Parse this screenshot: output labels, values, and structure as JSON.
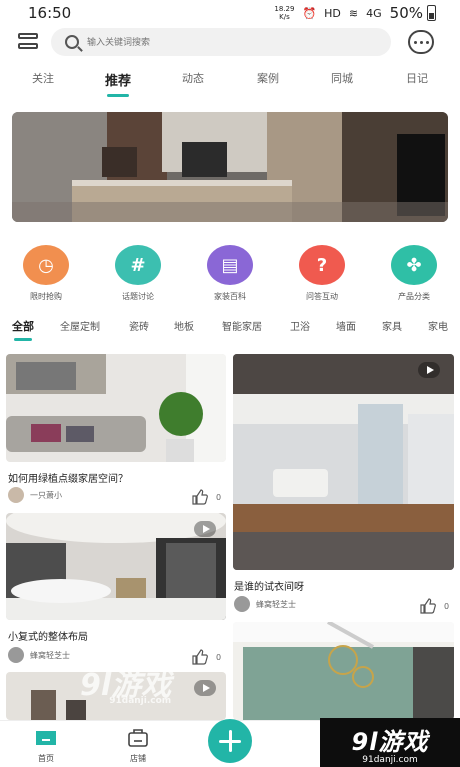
{
  "status": {
    "time": "16:50",
    "speed": "18.29\nK/s",
    "hd": "HD",
    "signal": "4G",
    "battery": "50%"
  },
  "search": {
    "placeholder": "输入关键词搜索"
  },
  "tabs": [
    "关注",
    "推荐",
    "动态",
    "案例",
    "同城",
    "日记"
  ],
  "categories": [
    {
      "label": "限时抢购",
      "color": "#f18f4f",
      "icon": "clock-icon"
    },
    {
      "label": "话题讨论",
      "color": "#3cbfb0",
      "icon": "hash-icon"
    },
    {
      "label": "家装百科",
      "color": "#8a67d6",
      "icon": "book-icon"
    },
    {
      "label": "问答互动",
      "color": "#f05a4f",
      "icon": "question-icon"
    },
    {
      "label": "产品分类",
      "color": "#2fbfa6",
      "icon": "grid-icon"
    }
  ],
  "subtabs": [
    "全部",
    "全屋定制",
    "瓷砖",
    "地板",
    "智能家居",
    "卫浴",
    "墙面",
    "家具",
    "家电"
  ],
  "cards": [
    {
      "title": "如何用绿植点缀家居空间？",
      "author": "一只萧小",
      "likes": "0"
    },
    {
      "title": "小复式的整体布局",
      "author": "蜂窝轻芝士",
      "likes": "0"
    },
    {
      "title": "是谁的试衣间呀",
      "author": "蜂窝轻芝士",
      "likes": "0"
    }
  ],
  "bottom_nav": {
    "home": "首页",
    "store": "店铺"
  },
  "watermark": {
    "brand": "9l游戏",
    "url": "91danji.com"
  },
  "colors": {
    "accent": "#22b5a7"
  }
}
